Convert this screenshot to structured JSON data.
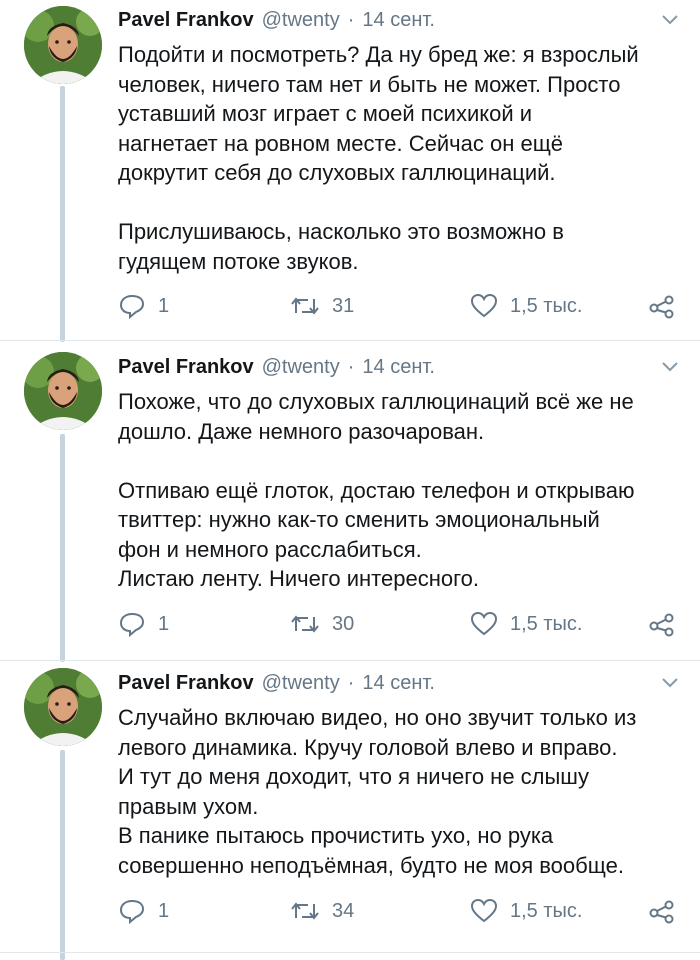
{
  "tweets": [
    {
      "author": "Pavel Frankov",
      "handle": "@twenty",
      "separator": "·",
      "date": "14 сент.",
      "paragraphs": [
        [
          "Подойти и посмотреть? Да ну бред же: я взрослый",
          "человек, ничего там нет и быть не может. Просто",
          "уставший мозг играет с моей психикой и",
          "нагнетает на ровном месте. Сейчас он ещё",
          "докрутит себя до слуховых галлюцинаций."
        ],
        [
          "Прислушиваюсь, насколько это возможно в",
          "гудящем потоке звуков."
        ]
      ],
      "replies": "1",
      "retweets": "31",
      "likes": "1,5 тыс."
    },
    {
      "author": "Pavel Frankov",
      "handle": "@twenty",
      "separator": "·",
      "date": "14 сент.",
      "paragraphs": [
        [
          "Похоже, что до слуховых галлюцинаций всё же не",
          "дошло. Даже немного разочарован."
        ],
        [
          "Отпиваю ещё глоток, достаю телефон и открываю",
          "твиттер: нужно как-то сменить эмоциональный",
          "фон и немного расслабиться.",
          "Листаю ленту. Ничего интересного."
        ]
      ],
      "replies": "1",
      "retweets": "30",
      "likes": "1,5 тыс."
    },
    {
      "author": "Pavel Frankov",
      "handle": "@twenty",
      "separator": "·",
      "date": "14 сент.",
      "paragraphs": [
        [
          "Случайно включаю видео, но оно звучит только из",
          "левого динамика. Кручу головой влево и вправо.",
          "И тут до меня доходит, что я ничего не слышу",
          "правым ухом.",
          "В панике пытаюсь прочистить ухо, но рука",
          "совершенно неподъёмная, будто не моя вообще."
        ]
      ],
      "replies": "1",
      "retweets": "34",
      "likes": "1,5 тыс."
    }
  ],
  "icons": {
    "reply": "reply-icon",
    "retweet": "retweet-icon",
    "like": "heart-icon",
    "share": "share-icon",
    "menu": "chevron-down-icon"
  },
  "colors": {
    "text": "#14171a",
    "muted": "#657786",
    "thread_line": "#c6d3dc",
    "divider": "#e1e8ed"
  }
}
